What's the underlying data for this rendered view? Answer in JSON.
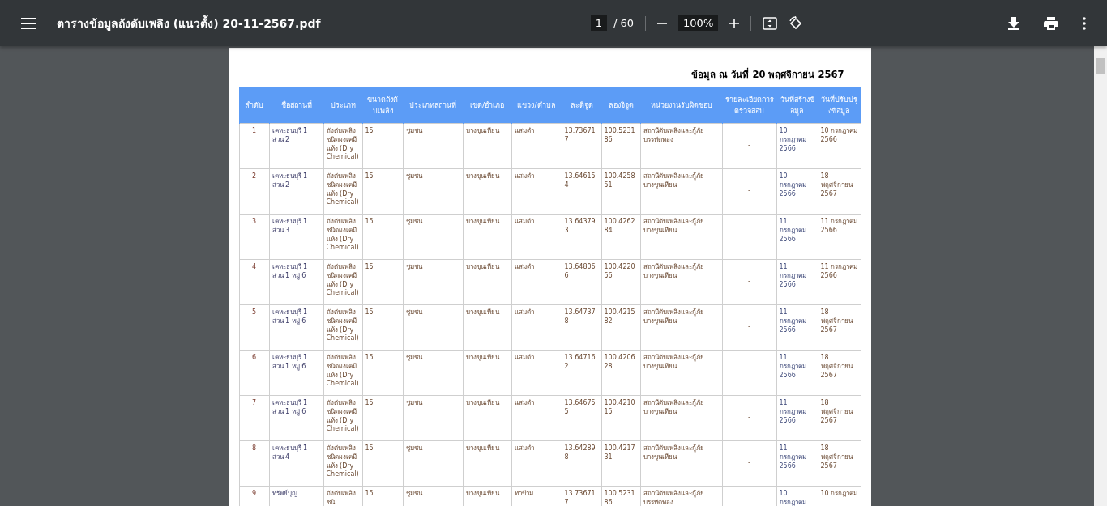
{
  "toolbar": {
    "title": "ตารางข้อมูลถังดับเพลิง (แนวตั้ง) 20-11-2567.pdf",
    "page": "1",
    "page_count": "/ 60",
    "zoom": "100%"
  },
  "document": {
    "date_note": "ข้อมูล ณ วันที่ 20 พฤศจิกายน 2567",
    "columns": [
      "ลำดับ",
      "ชื่อสถานที่",
      "ประเภท",
      "ขนาดถังดับเพลิง",
      "ประเภทสถานที่",
      "เขต/อำเภอ",
      "แขวง/ตำบล",
      "ละติจูด",
      "ลองจิจูด",
      "หน่วยงานรับผิดชอบ",
      "รายละเอียดการตรวจสอบ",
      "วันที่สร้างข้อมูล",
      "วันที่ปรับปรุงข้อมูล"
    ],
    "rows": [
      [
        "1",
        "เคหะธนบุรี 1 ส่วน 2",
        "ถังดับเพลิงชนิดผงเคมีแห้ง (Dry Chemical)",
        "15",
        "ชุมชน",
        "บางขุนเทียน",
        "แสมดำ",
        "13.736717",
        "100.523186",
        "สถานีดับเพลิงและกู้ภัยบรรทัดทอง",
        "-",
        "10 กรกฎาคม 2566",
        "10 กรกฎาคม 2566"
      ],
      [
        "2",
        "เคหะธนบุรี 1 ส่วน 2",
        "ถังดับเพลิงชนิดผงเคมีแห้ง (Dry Chemical)",
        "15",
        "ชุมชน",
        "บางขุนเทียน",
        "แสมดำ",
        "13.646154",
        "100.425851",
        "สถานีดับเพลิงและกู้ภัยบางขุนเทียน",
        "-",
        "10 กรกฎาคม 2566",
        "18 พฤศจิกายน 2567"
      ],
      [
        "3",
        "เคหะธนบุรี 1 ส่วน 3",
        "ถังดับเพลิงชนิดผงเคมีแห้ง (Dry Chemical)",
        "15",
        "ชุมชน",
        "บางขุนเทียน",
        "แสมดำ",
        "13.643793",
        "100.426284",
        "สถานีดับเพลิงและกู้ภัยบางขุนเทียน",
        "-",
        "11 กรกฎาคม 2566",
        "11 กรกฎาคม 2566"
      ],
      [
        "4",
        "เคหะธนบุรี 1 ส่วน 1 หมู่ 6",
        "ถังดับเพลิงชนิดผงเคมีแห้ง (Dry Chemical)",
        "15",
        "ชุมชน",
        "บางขุนเทียน",
        "แสมดำ",
        "13.648066",
        "100.422056",
        "สถานีดับเพลิงและกู้ภัยบางขุนเทียน",
        "-",
        "11 กรกฎาคม 2566",
        "11 กรกฎาคม 2566"
      ],
      [
        "5",
        "เคหะธนบุรี 1 ส่วน 1 หมู่ 6",
        "ถังดับเพลิงชนิดผงเคมีแห้ง (Dry Chemical)",
        "15",
        "ชุมชน",
        "บางขุนเทียน",
        "แสมดำ",
        "13.647378",
        "100.421582",
        "สถานีดับเพลิงและกู้ภัยบางขุนเทียน",
        "-",
        "11 กรกฎาคม 2566",
        "18 พฤศจิกายน 2567"
      ],
      [
        "6",
        "เคหะธนบุรี 1 ส่วน 1 หมู่ 6",
        "ถังดับเพลิงชนิดผงเคมีแห้ง (Dry Chemical)",
        "15",
        "ชุมชน",
        "บางขุนเทียน",
        "แสมดำ",
        "13.647162",
        "100.420628",
        "สถานีดับเพลิงและกู้ภัยบางขุนเทียน",
        "-",
        "11 กรกฎาคม 2566",
        "18 พฤศจิกายน 2567"
      ],
      [
        "7",
        "เคหะธนบุรี 1 ส่วน 1 หมู่ 6",
        "ถังดับเพลิงชนิดผงเคมีแห้ง (Dry Chemical)",
        "15",
        "ชุมชน",
        "บางขุนเทียน",
        "แสมดำ",
        "13.646755",
        "100.421015",
        "สถานีดับเพลิงและกู้ภัยบางขุนเทียน",
        "-",
        "11 กรกฎาคม 2566",
        "18 พฤศจิกายน 2567"
      ],
      [
        "8",
        "เคหะธนบุรี 1 ส่วน 4",
        "ถังดับเพลิงชนิดผงเคมีแห้ง (Dry Chemical)",
        "15",
        "ชุมชน",
        "บางขุนเทียน",
        "แสมดำ",
        "13.642898",
        "100.421731",
        "สถานีดับเพลิงและกู้ภัยบางขุนเทียน",
        "-",
        "11 กรกฎาคม 2566",
        "18 พฤศจิกายน 2567"
      ],
      [
        "9",
        "ทรัพย์บุญ",
        "ถังดับเพลิงชนิ",
        "15",
        "ชุมชน",
        "บางขุนเทียน",
        "ท่าข้าม",
        "13.736717",
        "100.523186",
        "สถานีดับเพลิงและกู้ภัยบรรทัดทอง",
        "",
        "10 กรกฎาคม",
        "10 กรกฎาคม"
      ]
    ]
  }
}
